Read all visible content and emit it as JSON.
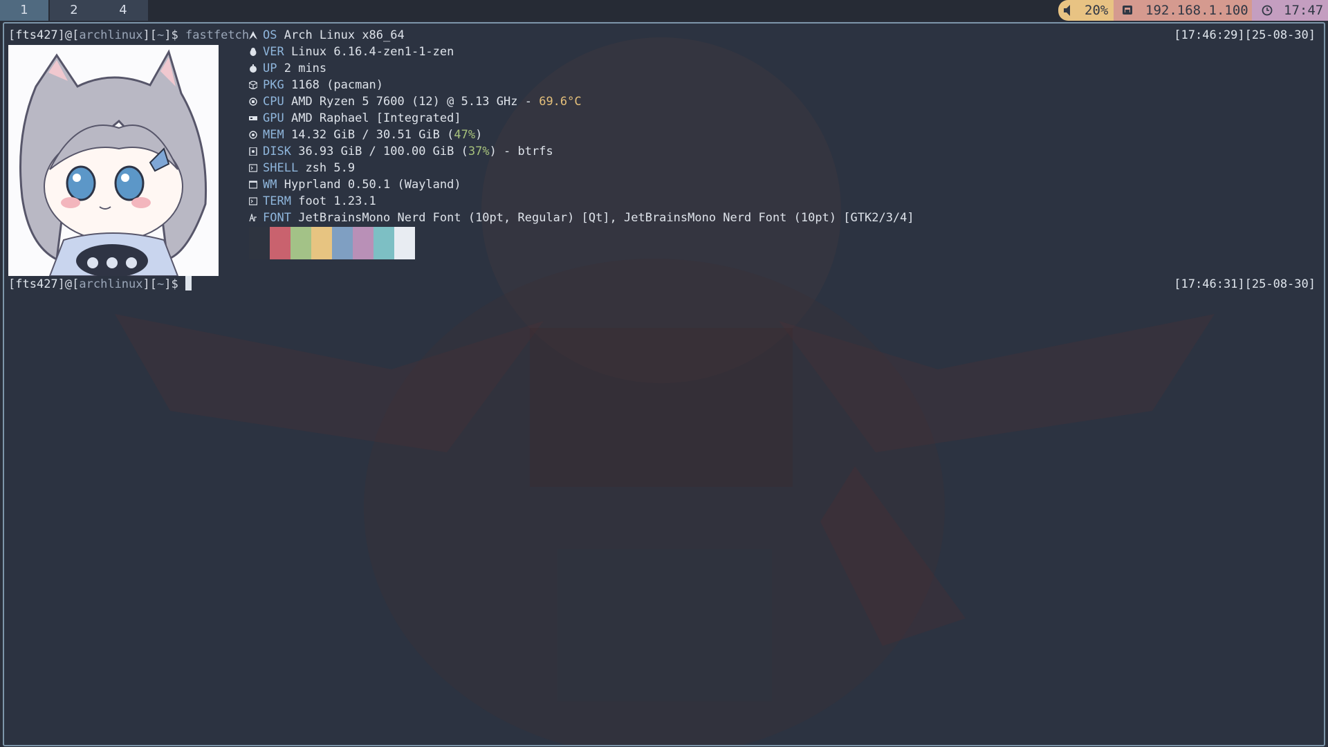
{
  "workspaces": [
    {
      "label": "1",
      "active": true
    },
    {
      "label": "2",
      "active": false
    },
    {
      "label": "4",
      "active": false
    }
  ],
  "statusbar": {
    "volume": "20%",
    "volume_icon": "speaker-icon",
    "ip": "192.168.1.100",
    "network_icon": "network-icon",
    "clock": "17:47",
    "clock_icon": "clock-icon"
  },
  "terminal": {
    "prompt": {
      "user": "fts427",
      "host": "archlinux",
      "path": "~"
    },
    "command": "fastfetch",
    "timestamp_1": "[17:46:29][25-08-30]",
    "timestamp_2": "[17:46:31][25-08-30]"
  },
  "fastfetch": {
    "os": {
      "key": "OS",
      "value": "Arch Linux x86_64",
      "icon": "arch-logo-icon"
    },
    "ver": {
      "key": "VER",
      "value": "Linux 6.16.4-zen1-1-zen",
      "icon": "penguin-icon"
    },
    "up": {
      "key": "UP",
      "value": "2 mins",
      "icon": "timer-icon"
    },
    "pkg": {
      "key": "PKG",
      "value": "1168 (pacman)",
      "icon": "package-icon"
    },
    "cpu": {
      "key": "CPU",
      "value": "AMD Ryzen 5 7600 (12) @ 5.13 GHz - ",
      "temp": "69.6°C",
      "icon": "cpu-icon"
    },
    "gpu": {
      "key": "GPU",
      "value": "AMD Raphael [Integrated]",
      "icon": "gpu-icon"
    },
    "mem": {
      "key": "MEM",
      "value": "14.32 GiB / 30.51 GiB (",
      "pct": "47%",
      "tail": ")",
      "icon": "memory-icon"
    },
    "disk": {
      "key": "DISK",
      "value": "36.93 GiB / 100.00 GiB (",
      "pct": "37%",
      "tail": ") - btrfs",
      "icon": "disk-icon"
    },
    "shell": {
      "key": "SHELL",
      "value": "zsh 5.9",
      "icon": "terminal-icon"
    },
    "wm": {
      "key": "WM",
      "value": "Hyprland 0.50.1 (Wayland)",
      "icon": "window-icon"
    },
    "term": {
      "key": "TERM",
      "value": "foot 1.23.1",
      "icon": "terminal-icon"
    },
    "font": {
      "key": "FONT",
      "value": "JetBrainsMono Nerd Font (10pt, Regular) [Qt], JetBrainsMono Nerd Font (10pt) [GTK2/3/4]",
      "icon": "font-icon"
    }
  },
  "palette": [
    "#2e3440",
    "#c9626e",
    "#a3c287",
    "#e7c481",
    "#7f9fc2",
    "#b990b7",
    "#7dbfc4",
    "#e8ecf2"
  ],
  "colors": {
    "accent": "#8fb6dc",
    "border": "#7d96aa",
    "temp": "#e5c07b",
    "good": "#a7c27c"
  }
}
